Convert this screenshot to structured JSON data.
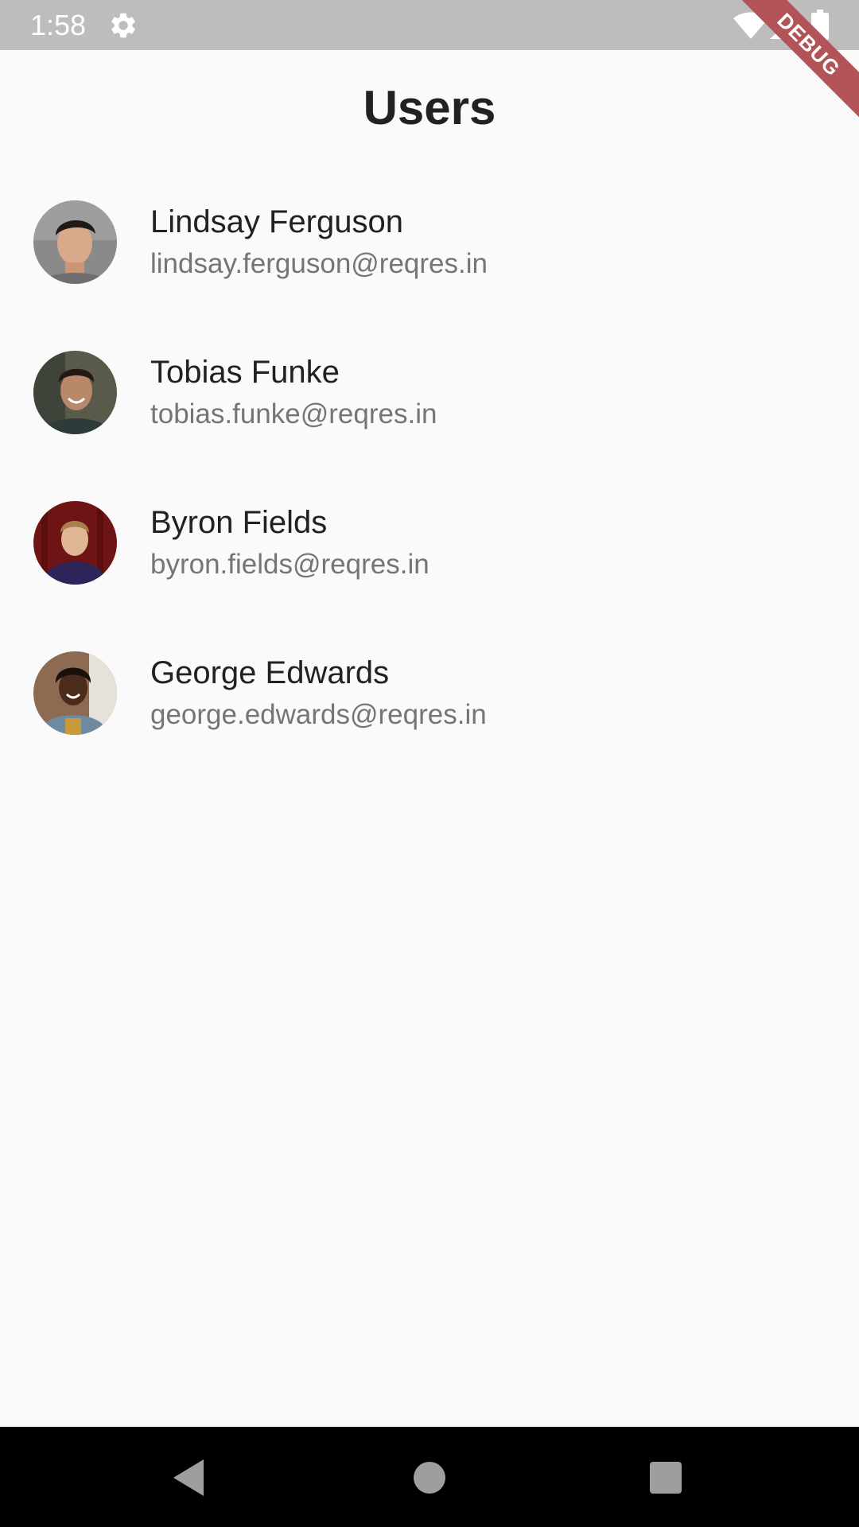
{
  "status_bar": {
    "time": "1:58",
    "icons": [
      "gear-icon",
      "wifi-icon",
      "signal-icon",
      "battery-icon"
    ]
  },
  "debug_banner": {
    "label": "DEBUG",
    "color": "#b25457"
  },
  "page": {
    "title": "Users"
  },
  "users": [
    {
      "name": "Lindsay Ferguson",
      "email": "lindsay.ferguson@reqres.in"
    },
    {
      "name": "Tobias Funke",
      "email": "tobias.funke@reqres.in"
    },
    {
      "name": "Byron Fields",
      "email": "byron.fields@reqres.in"
    },
    {
      "name": "George Edwards",
      "email": "george.edwards@reqres.in"
    }
  ],
  "nav_bar": {
    "icons": [
      "back-icon",
      "home-icon",
      "recents-icon"
    ]
  },
  "colors": {
    "background": "#fafafa",
    "status_bar": "#bdbdbd",
    "primary_text": "#212121",
    "secondary_text": "#757575",
    "nav_bar": "#000000"
  }
}
